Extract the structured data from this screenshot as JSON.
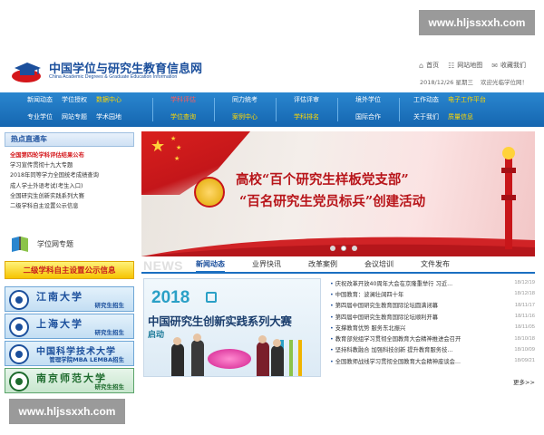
{
  "watermark": "www.hljssxxh.com",
  "header": {
    "site_title": "中国学位与研究生教育信息网",
    "site_subtitle": "China Academic Degrees & Graduate Education Information",
    "links": [
      "首页",
      "网站地图",
      "收藏我们"
    ],
    "date": "2018/12/26 星期三",
    "welcome": "欢迎光临学位网！"
  },
  "nav": {
    "group1": [
      "新闻动态",
      "学位授权",
      "数据中心",
      "专业学位",
      "网站专题",
      "学术园地"
    ],
    "group2": [
      "学科评估",
      "学位查询"
    ],
    "group3": [
      "同力统考",
      "案例中心"
    ],
    "group4": [
      "评估评审",
      "学科排名"
    ],
    "group5": [
      "境外学位",
      "国际合作"
    ],
    "group6": [
      "工作动态",
      "电子工作平台",
      "关于我们",
      "质量信息"
    ]
  },
  "sidebar": {
    "hot_title": "热点直通车",
    "hot_items": [
      "全国第四轮学科评估结果公布",
      "学习宣传贯彻十九大专题",
      "2018年同等学力全国统考成绩查询",
      "成人学士外语考试(考生入口)",
      "全国研究生创新实践系列大赛",
      "二级学科自主设置公示信息"
    ],
    "special_label": "学位网专题",
    "yellow_banner": "二级学科自主设置公示信息",
    "universities": [
      {
        "name": "江南大学",
        "sub": "研究生招生"
      },
      {
        "name": "上海大学",
        "sub": "研究生招生"
      },
      {
        "name": "中国科学技术大学",
        "sub": "管理学院MBA LEMBA招生"
      },
      {
        "name": "南京师范大学",
        "sub": "研究生招生"
      }
    ]
  },
  "hero": {
    "line1": "高校“百个研究生样板党支部”",
    "line2": "“百名研究生党员标兵”创建活动",
    "slides": 3,
    "active_slide": 1
  },
  "news": {
    "label": "NEWS",
    "tabs": [
      "新闻动态",
      "业界快讯",
      "改革案例",
      "会议培训",
      "文件发布"
    ],
    "active_tab": 0,
    "photo_year": "2018",
    "photo_title": "中国研究生创新实践系列大赛",
    "photo_kick": "启动",
    "items": [
      {
        "title": "庆祝改革开放40周年大会在京隆重举行 习近...",
        "date": "18/12/19"
      },
      {
        "title": "中国教育：波澜壮阔四十年",
        "date": "18/12/18"
      },
      {
        "title": "第四届中国研究生教育国际论坛圆满闭幕",
        "date": "18/11/17"
      },
      {
        "title": "第四届中国研究生教育国际论坛顺利开幕",
        "date": "18/11/16"
      },
      {
        "title": "支撑教育优势 服务东北振兴",
        "date": "18/11/05"
      },
      {
        "title": "教育部党组学习贯彻全国教育大会精神推进会召开",
        "date": "18/10/18"
      },
      {
        "title": "坚持科教融合 加强科技创新 提升教育服务技...",
        "date": "18/10/09"
      },
      {
        "title": "全国教师战线学习贯彻全国教育大会精神座谈会...",
        "date": "18/09/21"
      }
    ],
    "more": "更多>>"
  }
}
